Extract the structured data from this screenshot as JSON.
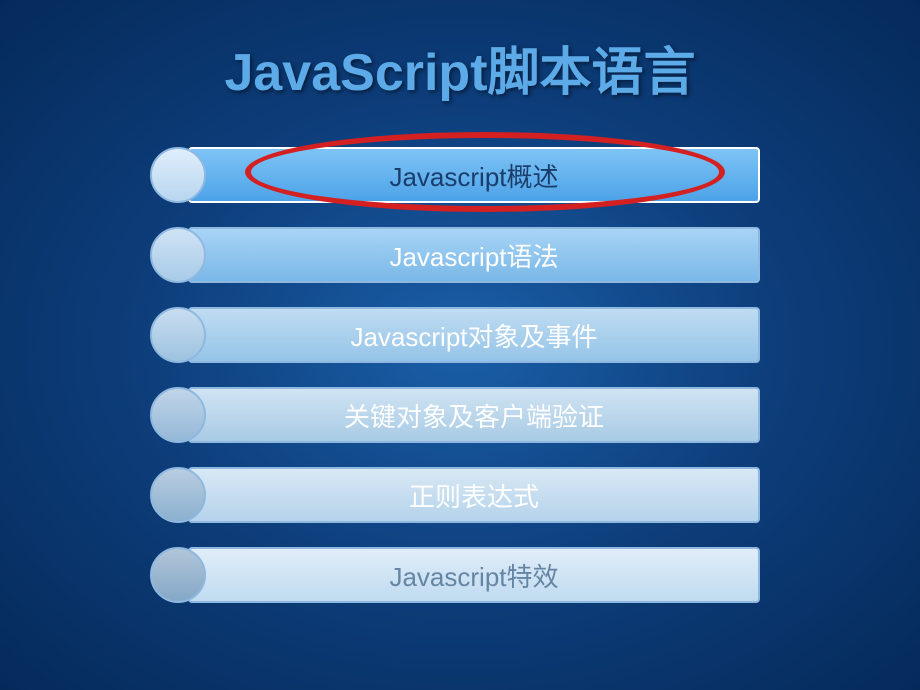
{
  "title": "JavaScript脚本语言",
  "highlightIndex": 0,
  "items": [
    {
      "label": "Javascript概述"
    },
    {
      "label": "Javascript语法"
    },
    {
      "label": "Javascript对象及事件"
    },
    {
      "label": "关键对象及客户端验证"
    },
    {
      "label": "正则表达式"
    },
    {
      "label": "Javascript特效"
    }
  ]
}
